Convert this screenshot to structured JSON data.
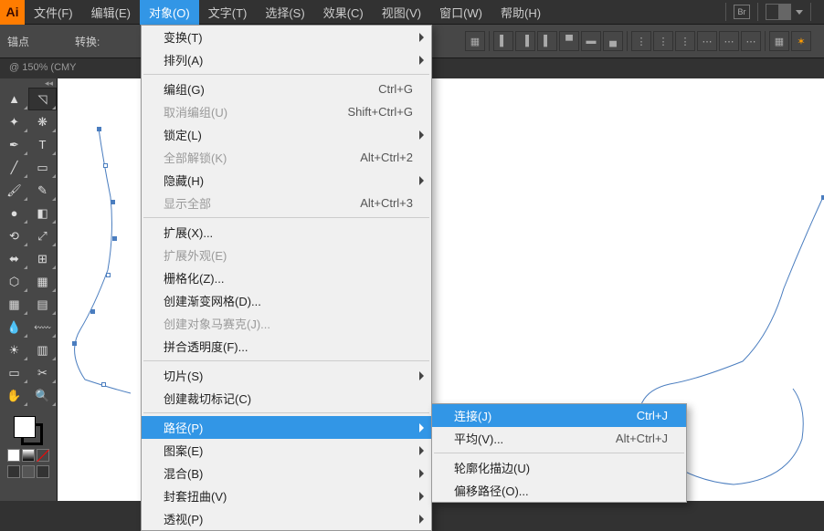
{
  "app": {
    "logo": "Ai"
  },
  "menubar": {
    "items": [
      {
        "label": "文件(F)"
      },
      {
        "label": "编辑(E)"
      },
      {
        "label": "对象(O)",
        "active": true
      },
      {
        "label": "文字(T)"
      },
      {
        "label": "选择(S)"
      },
      {
        "label": "效果(C)"
      },
      {
        "label": "视图(V)"
      },
      {
        "label": "窗口(W)"
      },
      {
        "label": "帮助(H)"
      }
    ]
  },
  "control_bar": {
    "anchor_label": "锚点",
    "convert_label": "转换:"
  },
  "doc_tab": "@ 150% (CMY",
  "object_menu": {
    "groups": [
      [
        {
          "label": "变换(T)",
          "sub": true
        },
        {
          "label": "排列(A)",
          "sub": true
        }
      ],
      [
        {
          "label": "编组(G)",
          "shortcut": "Ctrl+G"
        },
        {
          "label": "取消编组(U)",
          "shortcut": "Shift+Ctrl+G",
          "disabled": true
        },
        {
          "label": "锁定(L)",
          "sub": true
        },
        {
          "label": "全部解锁(K)",
          "shortcut": "Alt+Ctrl+2",
          "disabled": true
        },
        {
          "label": "隐藏(H)",
          "sub": true
        },
        {
          "label": "显示全部",
          "shortcut": "Alt+Ctrl+3",
          "disabled": true
        }
      ],
      [
        {
          "label": "扩展(X)..."
        },
        {
          "label": "扩展外观(E)",
          "disabled": true
        },
        {
          "label": "栅格化(Z)..."
        },
        {
          "label": "创建渐变网格(D)..."
        },
        {
          "label": "创建对象马赛克(J)...",
          "disabled": true
        },
        {
          "label": "拼合透明度(F)..."
        }
      ],
      [
        {
          "label": "切片(S)",
          "sub": true
        },
        {
          "label": "创建裁切标记(C)"
        }
      ],
      [
        {
          "label": "路径(P)",
          "sub": true,
          "highlight": true
        },
        {
          "label": "图案(E)",
          "sub": true
        },
        {
          "label": "混合(B)",
          "sub": true
        },
        {
          "label": "封套扭曲(V)",
          "sub": true
        },
        {
          "label": "透视(P)",
          "sub": true
        }
      ]
    ]
  },
  "path_submenu": {
    "items": [
      {
        "label": "连接(J)",
        "shortcut": "Ctrl+J",
        "highlight": true
      },
      {
        "label": "平均(V)...",
        "shortcut": "Alt+Ctrl+J"
      },
      {
        "sep": true
      },
      {
        "label": "轮廓化描边(U)"
      },
      {
        "label": "偏移路径(O)..."
      }
    ]
  },
  "tools": {
    "names": [
      "selection",
      "direct-select",
      "wand",
      "lasso",
      "pen",
      "type",
      "line",
      "rect",
      "brush",
      "pencil",
      "blob",
      "eraser",
      "rotate",
      "scale",
      "width",
      "free",
      "shape-builder",
      "perspective",
      "mesh",
      "gradient",
      "eyedrop",
      "blend",
      "symbol",
      "graph",
      "artboard",
      "slice",
      "hand",
      "zoom"
    ]
  }
}
